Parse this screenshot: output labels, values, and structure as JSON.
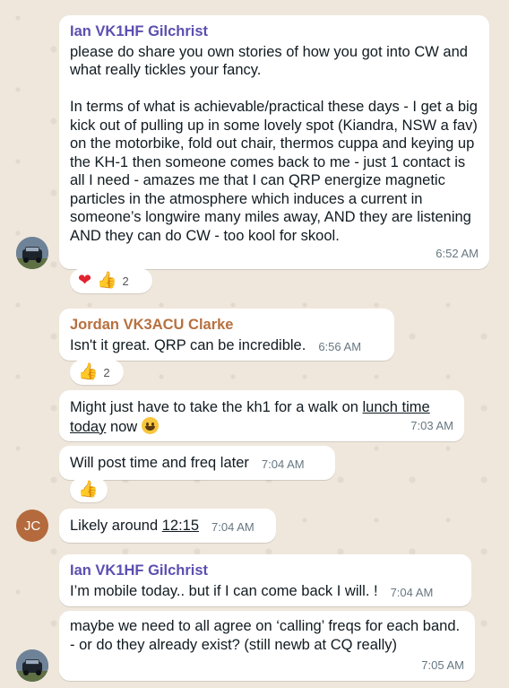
{
  "messages": [
    {
      "sender": "Ian VK1HF Gilchrist",
      "text": "please do share you own stories of how you got into CW and what really tickles your fancy.\n\nIn terms of what is achievable/practical these days - I get a big kick out of pulling up in some lovely spot (Kiandra, NSW a fav) on the motorbike, fold out chair, thermos cuppa and keying up the KH-1 then someone comes back to me - just 1 contact is all I need - amazes me that I can QRP energize magnetic particles in the atmosphere which induces a current in someone’s longwire many miles away, AND they are listening AND they can do CW - too kool for skool.",
      "time": "6:52 AM",
      "reactions": {
        "heart": "❤",
        "thumb": "👍",
        "count": "2"
      }
    },
    {
      "sender": "Jordan VK3ACU Clarke",
      "text": "Isn't it great. QRP can be incredible.",
      "time": "6:56 AM",
      "reactions": {
        "thumb": "👍",
        "count": "2"
      }
    },
    {
      "text_before": "Might just have to take the kh1 for a walk on ",
      "link1": "lunch time",
      "link2": "today",
      "text_after": " now ",
      "time": "7:03 AM"
    },
    {
      "text": "Will post time and freq later",
      "time": "7:04 AM",
      "reactions": {
        "thumb": "👍"
      }
    },
    {
      "avatar": "JC",
      "text_before": "Likely around ",
      "link": "12:15",
      "time": "7:04 AM"
    },
    {
      "sender": "Ian VK1HF Gilchrist",
      "text": "I’m mobile today.. but if I can come back I will. !",
      "time": "7:04 AM"
    },
    {
      "text": "maybe we need to all agree on ‘calling’ freqs for each band.  - or do they already exist? (still newb at CQ really)",
      "time": "7:05 AM"
    }
  ],
  "colors": {
    "background": "#efe7dc",
    "ian_name": "#5b4fb0",
    "jordan_name": "#b7703f",
    "jc_avatar": "#b46a3c"
  }
}
